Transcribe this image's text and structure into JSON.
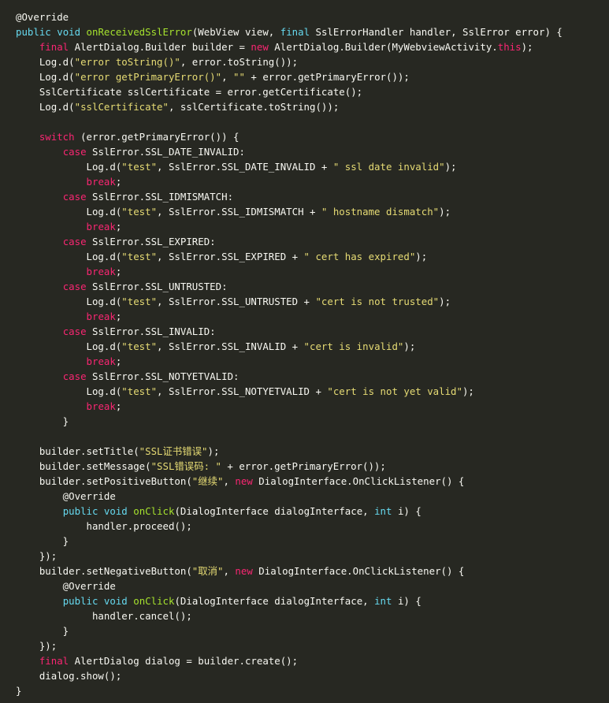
{
  "colors": {
    "background": "#272822",
    "plain": "#f8f8f2",
    "keyword": "#f92672",
    "keyword_blue": "#66d9ef",
    "function": "#a6e22e",
    "string": "#e6db74"
  },
  "code": {
    "lines": [
      [
        [
          "ann",
          "@Override"
        ]
      ],
      [
        [
          "kw2",
          "public"
        ],
        [
          "plain",
          " "
        ],
        [
          "kw2",
          "void"
        ],
        [
          "plain",
          " "
        ],
        [
          "fn",
          "onReceivedSslError"
        ],
        [
          "plain",
          "(WebView view, "
        ],
        [
          "kw2",
          "final"
        ],
        [
          "plain",
          " SslErrorHandler handler, SslError error) {"
        ]
      ],
      [
        [
          "plain",
          "    "
        ],
        [
          "kw",
          "final"
        ],
        [
          "plain",
          " AlertDialog.Builder builder = "
        ],
        [
          "kw",
          "new"
        ],
        [
          "plain",
          " AlertDialog.Builder(MyWebviewActivity."
        ],
        [
          "kw",
          "this"
        ],
        [
          "plain",
          ");"
        ]
      ],
      [
        [
          "plain",
          "    Log.d("
        ],
        [
          "str",
          "\"error toString()\""
        ],
        [
          "plain",
          ", error.toString());"
        ]
      ],
      [
        [
          "plain",
          "    Log.d("
        ],
        [
          "str",
          "\"error getPrimaryError()\""
        ],
        [
          "plain",
          ", "
        ],
        [
          "str",
          "\"\""
        ],
        [
          "plain",
          " + error.getPrimaryError());"
        ]
      ],
      [
        [
          "plain",
          "    SslCertificate sslCertificate = error.getCertificate();"
        ]
      ],
      [
        [
          "plain",
          "    Log.d("
        ],
        [
          "str",
          "\"sslCertificate\""
        ],
        [
          "plain",
          ", sslCertificate.toString());"
        ]
      ],
      [],
      [
        [
          "plain",
          "    "
        ],
        [
          "kw",
          "switch"
        ],
        [
          "plain",
          " (error.getPrimaryError()) {"
        ]
      ],
      [
        [
          "plain",
          "        "
        ],
        [
          "kw",
          "case"
        ],
        [
          "plain",
          " SslError.SSL_DATE_INVALID:"
        ]
      ],
      [
        [
          "plain",
          "            Log.d("
        ],
        [
          "str",
          "\"test\""
        ],
        [
          "plain",
          ", SslError.SSL_DATE_INVALID + "
        ],
        [
          "str",
          "\" ssl date invalid\""
        ],
        [
          "plain",
          ");"
        ]
      ],
      [
        [
          "plain",
          "            "
        ],
        [
          "kw",
          "break"
        ],
        [
          "plain",
          ";"
        ]
      ],
      [
        [
          "plain",
          "        "
        ],
        [
          "kw",
          "case"
        ],
        [
          "plain",
          " SslError.SSL_IDMISMATCH:"
        ]
      ],
      [
        [
          "plain",
          "            Log.d("
        ],
        [
          "str",
          "\"test\""
        ],
        [
          "plain",
          ", SslError.SSL_IDMISMATCH + "
        ],
        [
          "str",
          "\" hostname dismatch\""
        ],
        [
          "plain",
          ");"
        ]
      ],
      [
        [
          "plain",
          "            "
        ],
        [
          "kw",
          "break"
        ],
        [
          "plain",
          ";"
        ]
      ],
      [
        [
          "plain",
          "        "
        ],
        [
          "kw",
          "case"
        ],
        [
          "plain",
          " SslError.SSL_EXPIRED:"
        ]
      ],
      [
        [
          "plain",
          "            Log.d("
        ],
        [
          "str",
          "\"test\""
        ],
        [
          "plain",
          ", SslError.SSL_EXPIRED + "
        ],
        [
          "str",
          "\" cert has expired\""
        ],
        [
          "plain",
          ");"
        ]
      ],
      [
        [
          "plain",
          "            "
        ],
        [
          "kw",
          "break"
        ],
        [
          "plain",
          ";"
        ]
      ],
      [
        [
          "plain",
          "        "
        ],
        [
          "kw",
          "case"
        ],
        [
          "plain",
          " SslError.SSL_UNTRUSTED:"
        ]
      ],
      [
        [
          "plain",
          "            Log.d("
        ],
        [
          "str",
          "\"test\""
        ],
        [
          "plain",
          ", SslError.SSL_UNTRUSTED + "
        ],
        [
          "str",
          "\"cert is not trusted\""
        ],
        [
          "plain",
          ");"
        ]
      ],
      [
        [
          "plain",
          "            "
        ],
        [
          "kw",
          "break"
        ],
        [
          "plain",
          ";"
        ]
      ],
      [
        [
          "plain",
          "        "
        ],
        [
          "kw",
          "case"
        ],
        [
          "plain",
          " SslError.SSL_INVALID:"
        ]
      ],
      [
        [
          "plain",
          "            Log.d("
        ],
        [
          "str",
          "\"test\""
        ],
        [
          "plain",
          ", SslError.SSL_INVALID + "
        ],
        [
          "str",
          "\"cert is invalid\""
        ],
        [
          "plain",
          ");"
        ]
      ],
      [
        [
          "plain",
          "            "
        ],
        [
          "kw",
          "break"
        ],
        [
          "plain",
          ";"
        ]
      ],
      [
        [
          "plain",
          "        "
        ],
        [
          "kw",
          "case"
        ],
        [
          "plain",
          " SslError.SSL_NOTYETVALID:"
        ]
      ],
      [
        [
          "plain",
          "            Log.d("
        ],
        [
          "str",
          "\"test\""
        ],
        [
          "plain",
          ", SslError.SSL_NOTYETVALID + "
        ],
        [
          "str",
          "\"cert is not yet valid\""
        ],
        [
          "plain",
          ");"
        ]
      ],
      [
        [
          "plain",
          "            "
        ],
        [
          "kw",
          "break"
        ],
        [
          "plain",
          ";"
        ]
      ],
      [
        [
          "plain",
          "        }"
        ]
      ],
      [],
      [
        [
          "plain",
          "    builder.setTitle("
        ],
        [
          "str",
          "\"SSL证书错误\""
        ],
        [
          "plain",
          ");"
        ]
      ],
      [
        [
          "plain",
          "    builder.setMessage("
        ],
        [
          "str",
          "\"SSL错误码: \""
        ],
        [
          "plain",
          " + error.getPrimaryError());"
        ]
      ],
      [
        [
          "plain",
          "    builder.setPositiveButton("
        ],
        [
          "str",
          "\"继续\""
        ],
        [
          "plain",
          ", "
        ],
        [
          "kw",
          "new"
        ],
        [
          "plain",
          " DialogInterface.OnClickListener() {"
        ]
      ],
      [
        [
          "plain",
          "        @Override"
        ]
      ],
      [
        [
          "plain",
          "        "
        ],
        [
          "kw2",
          "public"
        ],
        [
          "plain",
          " "
        ],
        [
          "kw2",
          "void"
        ],
        [
          "plain",
          " "
        ],
        [
          "fn",
          "onClick"
        ],
        [
          "plain",
          "(DialogInterface dialogInterface, "
        ],
        [
          "kw2",
          "int"
        ],
        [
          "plain",
          " i) {"
        ]
      ],
      [
        [
          "plain",
          "            handler.proceed();"
        ]
      ],
      [
        [
          "plain",
          "        }"
        ]
      ],
      [
        [
          "plain",
          "    });"
        ]
      ],
      [
        [
          "plain",
          "    builder.setNegativeButton("
        ],
        [
          "str",
          "\"取消\""
        ],
        [
          "plain",
          ", "
        ],
        [
          "kw",
          "new"
        ],
        [
          "plain",
          " DialogInterface.OnClickListener() {"
        ]
      ],
      [
        [
          "plain",
          "        @Override"
        ]
      ],
      [
        [
          "plain",
          "        "
        ],
        [
          "kw2",
          "public"
        ],
        [
          "plain",
          " "
        ],
        [
          "kw2",
          "void"
        ],
        [
          "plain",
          " "
        ],
        [
          "fn",
          "onClick"
        ],
        [
          "plain",
          "(DialogInterface dialogInterface, "
        ],
        [
          "kw2",
          "int"
        ],
        [
          "plain",
          " i) {"
        ]
      ],
      [
        [
          "plain",
          "             handler.cancel();"
        ]
      ],
      [
        [
          "plain",
          "        }"
        ]
      ],
      [
        [
          "plain",
          "    });"
        ]
      ],
      [
        [
          "plain",
          "    "
        ],
        [
          "kw",
          "final"
        ],
        [
          "plain",
          " AlertDialog dialog = builder.create();"
        ]
      ],
      [
        [
          "plain",
          "    dialog.show();"
        ]
      ],
      [
        [
          "plain",
          "}"
        ]
      ]
    ]
  }
}
